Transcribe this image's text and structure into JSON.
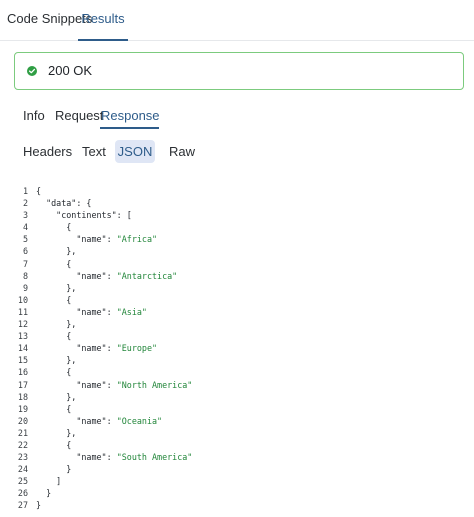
{
  "top_tabs": [
    "Code Snippets",
    "Results"
  ],
  "status": {
    "text": "200 OK",
    "color": "#2f9e44"
  },
  "sub_tabs": [
    "Info",
    "Request",
    "Response"
  ],
  "format_tabs": [
    "Headers",
    "Text",
    "JSON",
    "Raw"
  ],
  "code_lines": [
    {
      "num": "1",
      "text": "{"
    },
    {
      "num": "2",
      "text": "  \"data\": {"
    },
    {
      "num": "3",
      "text": "    \"continents\": ["
    },
    {
      "num": "4",
      "text": "      {"
    },
    {
      "num": "5",
      "text": "        \"name\": ",
      "str": "\"Africa\""
    },
    {
      "num": "6",
      "text": "      },"
    },
    {
      "num": "7",
      "text": "      {"
    },
    {
      "num": "8",
      "text": "        \"name\": ",
      "str": "\"Antarctica\""
    },
    {
      "num": "9",
      "text": "      },"
    },
    {
      "num": "10",
      "text": "      {"
    },
    {
      "num": "11",
      "text": "        \"name\": ",
      "str": "\"Asia\""
    },
    {
      "num": "12",
      "text": "      },"
    },
    {
      "num": "13",
      "text": "      {"
    },
    {
      "num": "14",
      "text": "        \"name\": ",
      "str": "\"Europe\""
    },
    {
      "num": "15",
      "text": "      },"
    },
    {
      "num": "16",
      "text": "      {"
    },
    {
      "num": "17",
      "text": "        \"name\": ",
      "str": "\"North America\""
    },
    {
      "num": "18",
      "text": "      },"
    },
    {
      "num": "19",
      "text": "      {"
    },
    {
      "num": "20",
      "text": "        \"name\": ",
      "str": "\"Oceania\""
    },
    {
      "num": "21",
      "text": "      },"
    },
    {
      "num": "22",
      "text": "      {"
    },
    {
      "num": "23",
      "text": "        \"name\": ",
      "str": "\"South America\""
    },
    {
      "num": "24",
      "text": "      }"
    },
    {
      "num": "25",
      "text": "    ]"
    },
    {
      "num": "26",
      "text": "  }"
    },
    {
      "num": "27",
      "text": "}"
    }
  ]
}
